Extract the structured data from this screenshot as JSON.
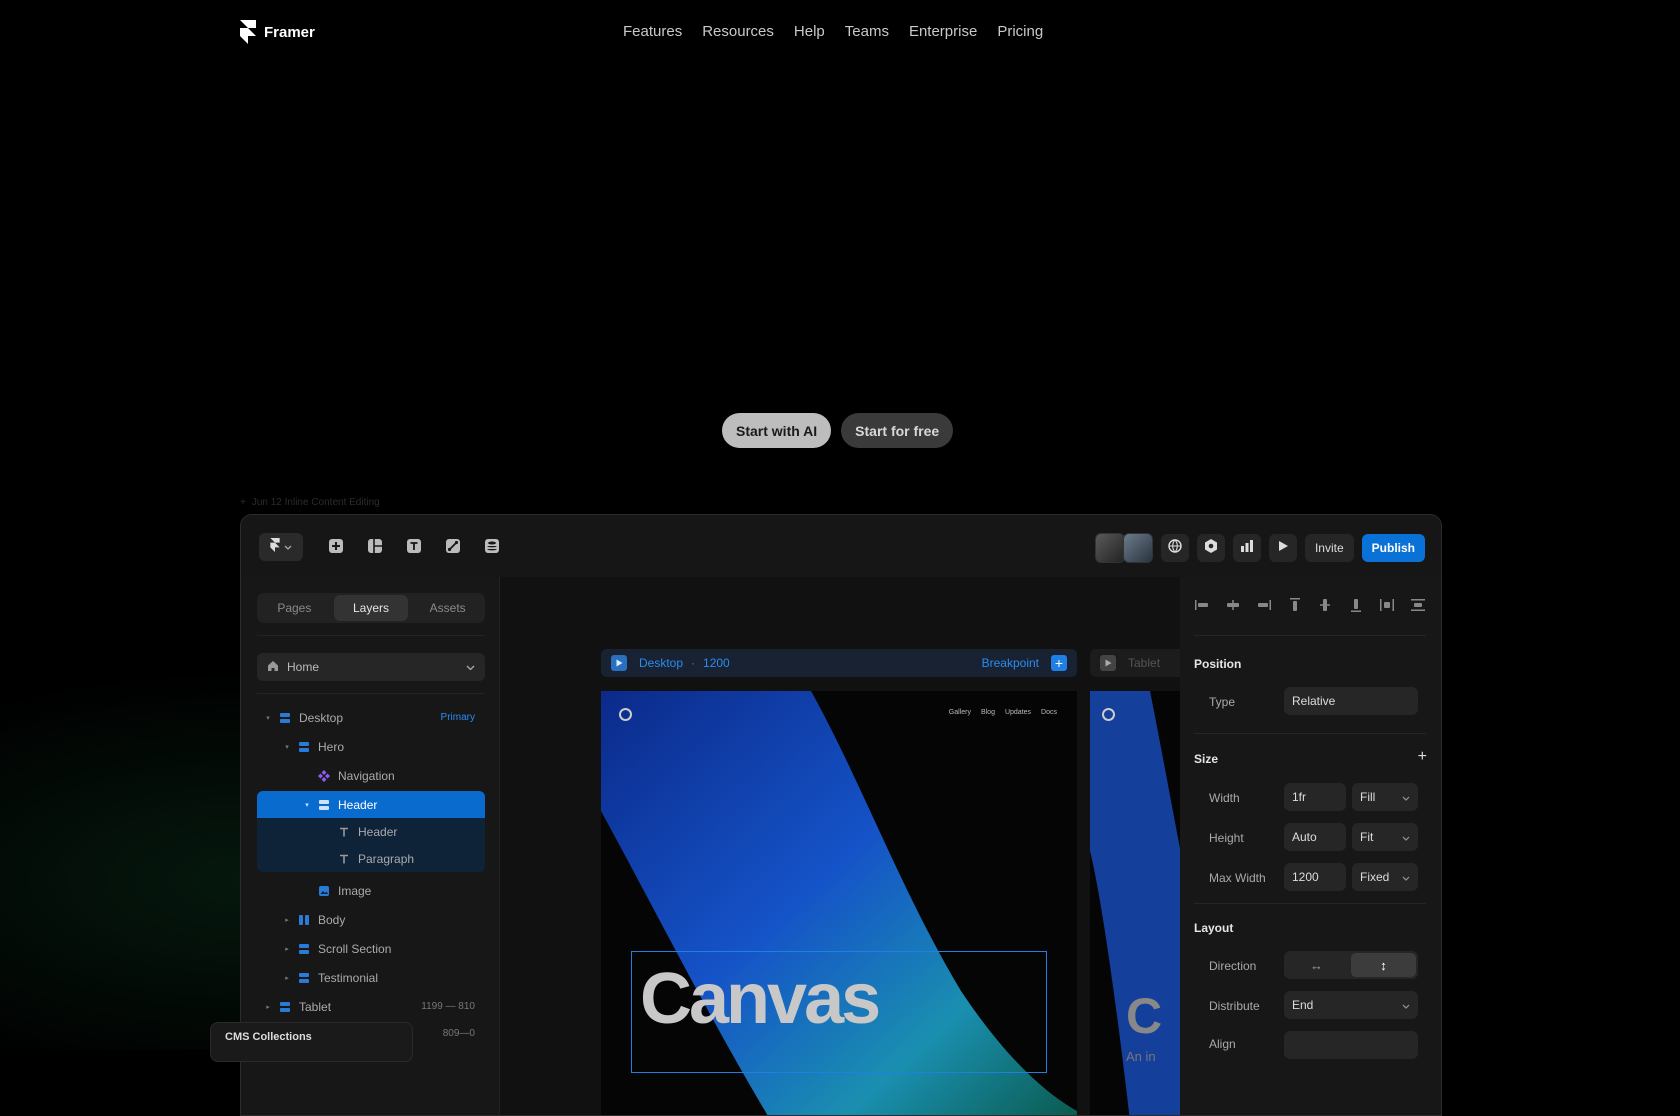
{
  "brand": {
    "name": "Framer"
  },
  "nav": {
    "links": [
      "Features",
      "Resources",
      "Help",
      "Teams",
      "Enterprise",
      "Pricing"
    ]
  },
  "hero": {
    "cta_primary": "Start with AI",
    "cta_secondary": "Start for free",
    "changelog": "Jun 12 Inline Content Editing"
  },
  "toolbar": {
    "invite_label": "Invite",
    "publish_label": "Publish",
    "tools": [
      "plus-icon",
      "layout-icon",
      "text-icon",
      "link-icon",
      "database-icon"
    ]
  },
  "left_panel": {
    "tabs": [
      "Pages",
      "Layers",
      "Assets"
    ],
    "active_tab": "Layers",
    "page_select": "Home",
    "layers": [
      {
        "name": "Desktop",
        "badge": "Primary"
      },
      {
        "name": "Hero"
      },
      {
        "name": "Navigation"
      },
      {
        "name": "Header"
      },
      {
        "name": "Header"
      },
      {
        "name": "Paragraph"
      },
      {
        "name": "Image"
      },
      {
        "name": "Body"
      },
      {
        "name": "Scroll Section"
      },
      {
        "name": "Testimonial"
      },
      {
        "name": "Tablet",
        "dims": "1199 — 810"
      },
      {
        "name": "",
        "dims": "809—0"
      }
    ],
    "cms_title": "CMS Collections"
  },
  "canvas": {
    "frame_label": "Desktop",
    "frame_sep": "·",
    "frame_width": "1200",
    "breakpoint_label": "Breakpoint",
    "frame2_label": "Tablet",
    "site_nav": [
      "Gallery",
      "Blog",
      "Updates",
      "Docs"
    ],
    "heading": "Canvas",
    "frame2_heading": "C",
    "frame2_sub": "An in"
  },
  "right_panel": {
    "position_title": "Position",
    "type_label": "Type",
    "type_value": "Relative",
    "size_title": "Size",
    "width_label": "Width",
    "width_value": "1fr",
    "width_mode": "Fill",
    "height_label": "Height",
    "height_value": "Auto",
    "height_mode": "Fit",
    "maxwidth_label": "Max Width",
    "maxwidth_value": "1200",
    "maxwidth_mode": "Fixed",
    "layout_title": "Layout",
    "direction_label": "Direction",
    "distribute_label": "Distribute",
    "distribute_value": "End",
    "align_label": "Align"
  },
  "colors": {
    "accent": "#0A72D6",
    "background": "#000000",
    "panel": "#171717"
  }
}
